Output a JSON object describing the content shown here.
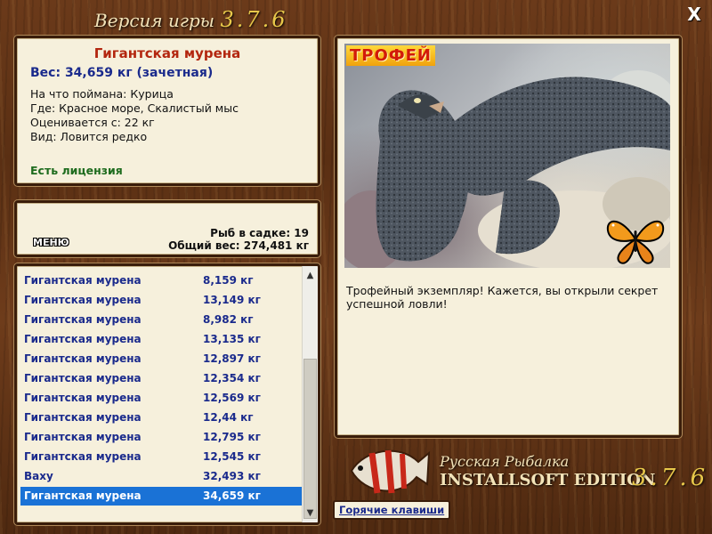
{
  "window": {
    "title_prefix": "Версия игры",
    "version": "3.7.6",
    "close_label": "X"
  },
  "catch_info": {
    "name": "Гигантская мурена",
    "weight": "Вес: 34,659 кг (зачетная)",
    "bait": "На что поймана: Курица",
    "location": "Где: Красное море, Скалистый мыс",
    "min_weight": "Оценивается с: 22 кг",
    "rarity": "Вид: Ловится редко",
    "license": "Есть лицензия"
  },
  "keepnet": {
    "menu_label": "МЕНЮ",
    "count": "Рыб в садке: 19",
    "total_weight": "Общий вес: 274,481 кг"
  },
  "fish_list": [
    {
      "name": "Гигантская мурена",
      "weight": "8,159 кг"
    },
    {
      "name": "Гигантская мурена",
      "weight": "13,149 кг"
    },
    {
      "name": "Гигантская мурена",
      "weight": "8,982 кг"
    },
    {
      "name": "Гигантская мурена",
      "weight": "13,135 кг"
    },
    {
      "name": "Гигантская мурена",
      "weight": "12,897 кг"
    },
    {
      "name": "Гигантская мурена",
      "weight": "12,354 кг"
    },
    {
      "name": "Гигантская мурена",
      "weight": "12,569 кг"
    },
    {
      "name": "Гигантская мурена",
      "weight": "12,44 кг"
    },
    {
      "name": "Гигантская мурена",
      "weight": "12,795 кг"
    },
    {
      "name": "Гигантская мурена",
      "weight": "12,545 кг"
    },
    {
      "name": "Ваху",
      "weight": "32,493 кг"
    },
    {
      "name": "Гигантская мурена",
      "weight": "34,659 кг"
    }
  ],
  "selected_index": 11,
  "trophy": {
    "badge": "ТРОФЕЙ",
    "description": "Трофейный экземпляр! Кажется, вы открыли секрет успешной ловли!"
  },
  "hotkeys_label": "Горячие клавиши",
  "brand": {
    "line1": "Русская Рыбалка",
    "line2": "INSTALLSOFT EDITION",
    "version": "3.7.6"
  },
  "colors": {
    "accent_red": "#b3260f",
    "text_blue": "#1a2a8c",
    "selection": "#1a72d6",
    "license_green": "#1d6b1d"
  }
}
